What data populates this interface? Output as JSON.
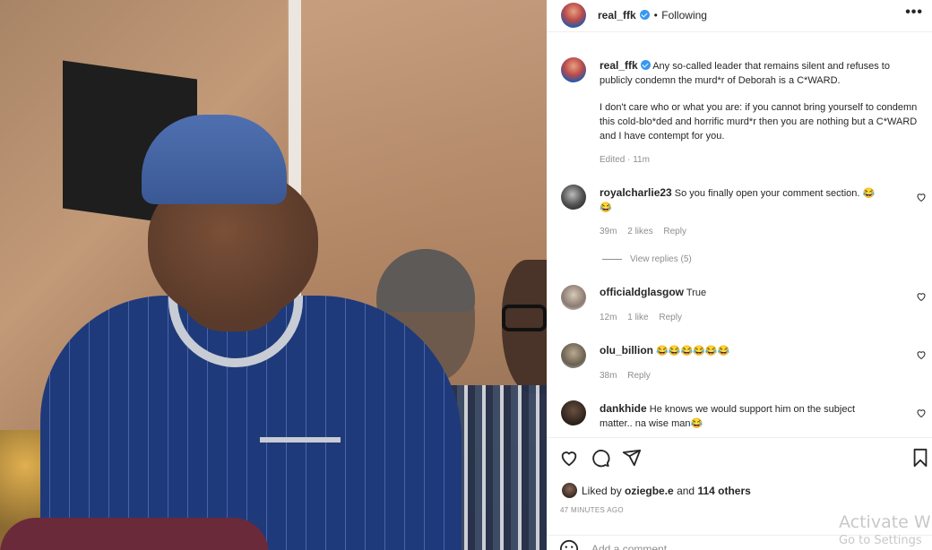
{
  "post": {
    "username": "real_ffk",
    "separator": "•",
    "follow_status": "Following",
    "more_label": "•••",
    "caption_p1": "Any so-called leader that remains silent and refuses to publicly condemn the murd*r of Deborah is a C*WARD.",
    "caption_p2": "I don't care who or what you are: if you cannot bring yourself to condemn this cold-blo*ded and horrific murd*r then you are nothing but a C*WARD and I have contempt for you.",
    "edited": "Edited · 11m"
  },
  "comments": [
    {
      "username": "royalcharlie23",
      "text": "So you finally open your comment section. 😂",
      "text2": "😂",
      "time": "39m",
      "likes": "2 likes",
      "reply": "Reply",
      "view_replies": "View replies (5)"
    },
    {
      "username": "officialdglasgow",
      "text": "True",
      "time": "12m",
      "likes": "1 like",
      "reply": "Reply"
    },
    {
      "username": "olu_billion",
      "text": "😂😂😂😂😂😂",
      "time": "38m",
      "reply": "Reply"
    },
    {
      "username": "dankhide",
      "text": "He knows we would support him on the subject",
      "text2": "matter.. na wise man😂"
    }
  ],
  "engagement": {
    "liked_by_prefix": "Liked by",
    "liked_by_user": "oziegbe.e",
    "liked_by_and": "and",
    "others": "114 others",
    "time_ago": "47 MINUTES AGO",
    "add_comment": "Add a comment..."
  },
  "watermark": {
    "line1": "Activate W",
    "line2": "Go to Settings"
  },
  "colors": {
    "verified": "#3897f0",
    "muted": "#8e8e8e",
    "text": "#262626"
  }
}
